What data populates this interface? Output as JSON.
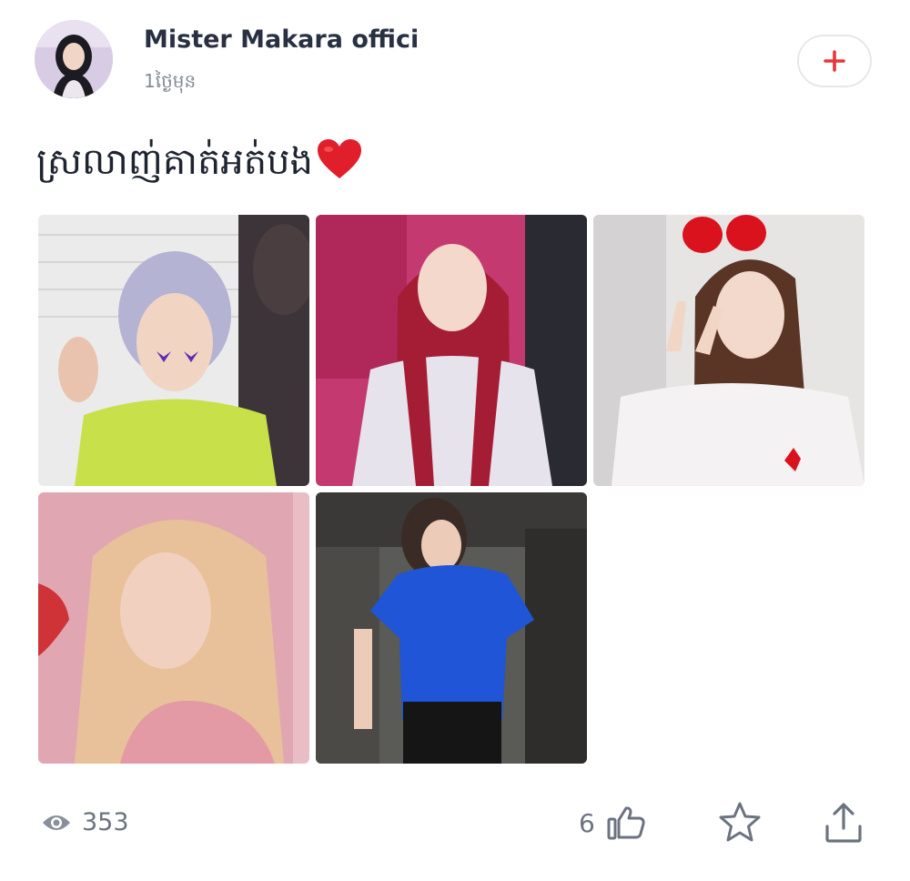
{
  "post": {
    "author": "Mister Makara offici",
    "time_ago": "1ថ្ងៃមុន",
    "text": "ស្រលាញ់គាត់អត់បង",
    "follow_icon": "plus-icon",
    "photos": [
      {
        "name": "photo-1",
        "hair": "#b5b3d4",
        "shirt": "#c8e04a",
        "bg": "#e9e6e6"
      },
      {
        "name": "photo-2",
        "hair": "#a51d35",
        "shirt": "#e6e3ec",
        "bg": "#c43a70"
      },
      {
        "name": "photo-3",
        "hair": "#5a3526",
        "shirt": "#f4f2f2",
        "bg": "#e7e4e4"
      },
      {
        "name": "photo-4",
        "hair": "#e8c19a",
        "shirt": "#e39aa4",
        "bg": "#e0a7b2"
      },
      {
        "name": "photo-5",
        "hair": "#3a2b26",
        "shirt": "#1f55d6",
        "bg": "#5a5a57"
      }
    ]
  },
  "stats": {
    "views": "353",
    "likes": "6"
  },
  "icons": {
    "views": "eye-icon",
    "likes": "thumbs-up-icon",
    "favorite": "star-icon",
    "share": "share-icon"
  },
  "colors": {
    "accent": "#e8363a",
    "icon_gray": "#6c7380"
  }
}
